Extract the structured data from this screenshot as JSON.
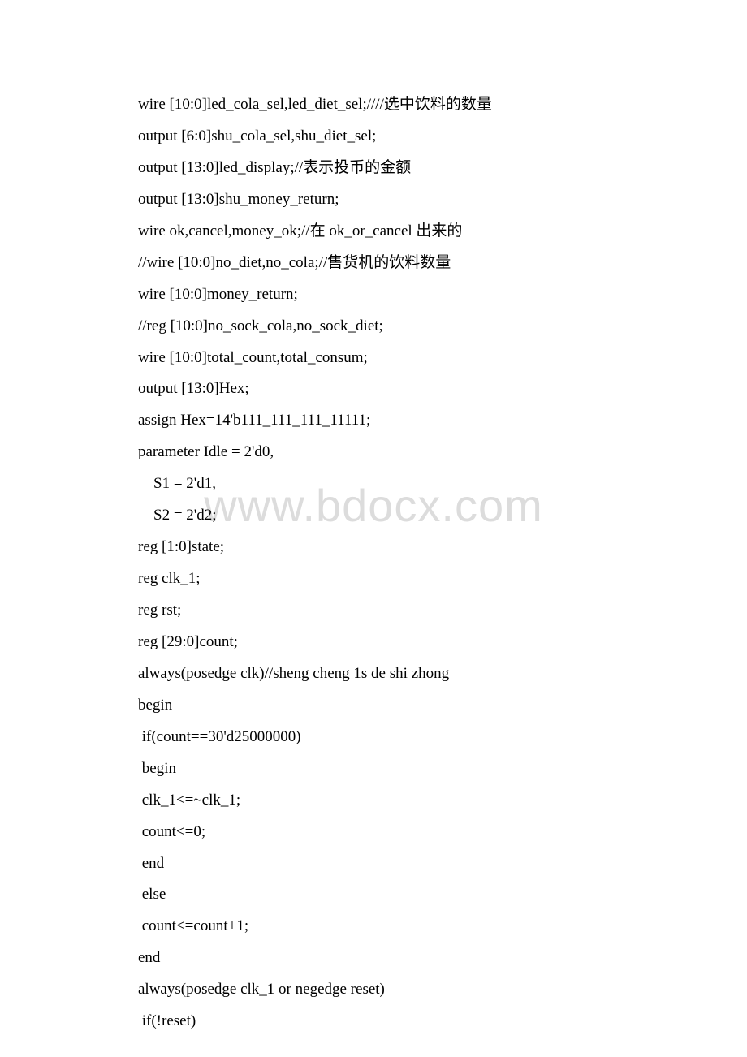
{
  "watermark": "www.bdocx.com",
  "lines": [
    "wire [10:0]led_cola_sel,led_diet_sel;////选中饮料的数量",
    "output [6:0]shu_cola_sel,shu_diet_sel;",
    "output [13:0]led_display;//表示投币的金额",
    "output [13:0]shu_money_return;",
    "wire ok,cancel,money_ok;//在 ok_or_cancel 出来的",
    "//wire [10:0]no_diet,no_cola;//售货机的饮料数量",
    "wire [10:0]money_return;",
    "//reg [10:0]no_sock_cola,no_sock_diet;",
    "wire [10:0]total_count,total_consum;",
    "output [13:0]Hex;",
    "assign Hex=14'b111_111_111_11111;",
    "parameter Idle = 2'd0,",
    "    S1 = 2'd1,",
    "    S2 = 2'd2;",
    "reg [1:0]state;",
    "reg clk_1;",
    "reg rst;",
    "reg [29:0]count;",
    "always(posedge clk)//sheng cheng 1s de shi zhong",
    "begin",
    " if(count==30'd25000000)",
    " begin",
    " clk_1<=~clk_1;",
    " count<=0;",
    " end",
    " else",
    " count<=count+1;",
    "end",
    "always(posedge clk_1 or negedge reset)",
    " if(!reset)"
  ]
}
